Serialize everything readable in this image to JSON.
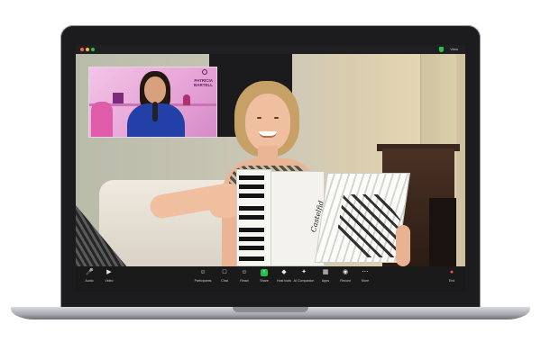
{
  "window": {
    "view_label": "View"
  },
  "thumbnail": {
    "brand_line1": "PATRICIA",
    "brand_line2": "BARTELL"
  },
  "instrument": {
    "brand": "Castelfid"
  },
  "controls": {
    "audio": "Audio",
    "video": "Video",
    "participants": "Participants",
    "chat": "Chat",
    "react": "React",
    "share": "Share",
    "host_tools": "Host tools",
    "ai_companion": "AI Companion",
    "apps": "Apps",
    "record": "Record",
    "more": "More",
    "end": "End"
  },
  "colors": {
    "share_accent": "#1fbf4a",
    "end_accent": "#ff4d4d",
    "security_shield": "#2fbf4f"
  }
}
